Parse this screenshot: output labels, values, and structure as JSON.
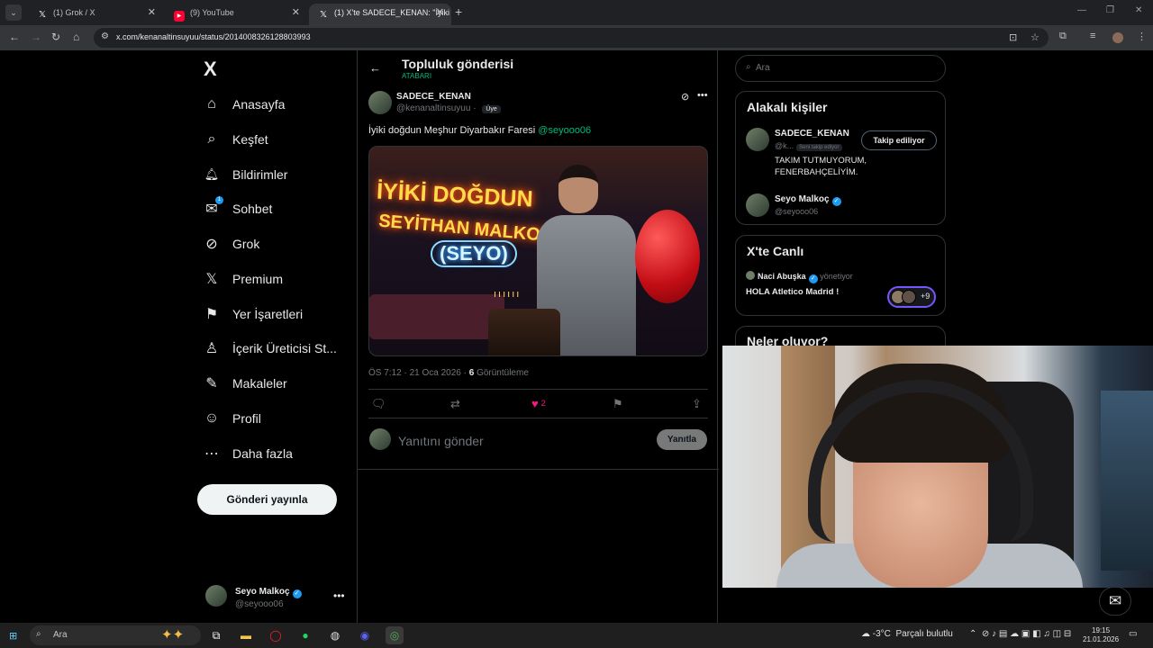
{
  "browser": {
    "tabs": [
      {
        "title": "(1) Grok / X",
        "icon": "x-logo-icon",
        "active": false
      },
      {
        "title": "(9) YouTube",
        "icon": "youtube-icon",
        "active": false
      },
      {
        "title": "(1) X'te SADECE_KENAN: \"İyiki d",
        "icon": "x-logo-icon",
        "active": true
      }
    ],
    "url": "x.com/kenanaltinsuyuu/status/2014008326128803993"
  },
  "sidebar": {
    "logo": "X",
    "items": [
      {
        "label": "Anasayfa",
        "icon": "home-icon",
        "glyph": "⌂"
      },
      {
        "label": "Keşfet",
        "icon": "search-icon",
        "glyph": "⌕"
      },
      {
        "label": "Bildirimler",
        "icon": "bell-icon",
        "glyph": "🔔︎"
      },
      {
        "label": "Sohbet",
        "icon": "mail-icon",
        "glyph": "✉",
        "badge": "1"
      },
      {
        "label": "Grok",
        "icon": "grok-icon",
        "glyph": "⊘"
      },
      {
        "label": "Premium",
        "icon": "x-premium-icon",
        "glyph": "𝕏"
      },
      {
        "label": "Yer İşaretleri",
        "icon": "bookmark-icon",
        "glyph": "⚑"
      },
      {
        "label": "İçerik Üreticisi St...",
        "icon": "creator-studio-icon",
        "glyph": "♙"
      },
      {
        "label": "Makaleler",
        "icon": "article-icon",
        "glyph": "✎"
      },
      {
        "label": "Profil",
        "icon": "profile-icon",
        "glyph": "☺"
      },
      {
        "label": "Daha fazla",
        "icon": "more-circle-icon",
        "glyph": "⋯"
      }
    ],
    "post_button": "Gönderi yayınla",
    "account": {
      "name": "Seyo Malkoç",
      "handle": "@seyooo06"
    }
  },
  "main": {
    "title": "Topluluk gönderisi",
    "subtitle": "ATABARI",
    "tweet": {
      "author_name": "SADECE_KENAN",
      "author_handle": "@kenanaltinsuyuu",
      "separator": " · ",
      "role": "Üye",
      "text": "İyiki doğdun Meşhur Diyarbakır Faresi ",
      "mention": "@seyooo06",
      "image_text": [
        "İYİKİ DOĞDUN",
        "SEYİTHAN MALKOÇ",
        "(SEYO)"
      ],
      "time": "ÖS 7:12 · 21 Oca 2026 · ",
      "views_count": "6",
      "views_label": " Görüntüleme",
      "likes": "2"
    },
    "reply": {
      "placeholder": "Yanıtını gönder",
      "button": "Yanıtla"
    }
  },
  "right": {
    "search_placeholder": "Ara",
    "related": {
      "title": "Alakalı kişiler",
      "people": [
        {
          "name": "SADECE_KENAN",
          "handle": "@k...",
          "follows_you": "Seni takip ediyor",
          "button": "Takip ediliyor",
          "bio": "TAKIM TUTMUYORUM, FENERBAHÇELİYİM."
        },
        {
          "name": "Seyo Malkoç",
          "handle": "@seyooo06"
        }
      ]
    },
    "live": {
      "title": "X'te Canlı",
      "host": "Naci Abuşka",
      "host_role": "yönetiyor",
      "event": "HOLA Atletico Madrid !",
      "more_count": "+9"
    },
    "trending_title": "Neler oluyor?"
  },
  "taskbar": {
    "search_placeholder": "Ara",
    "weather": "-3°C",
    "weather_desc": "Parçalı bulutlu",
    "time": "19:15",
    "date": "21.01.2026"
  }
}
